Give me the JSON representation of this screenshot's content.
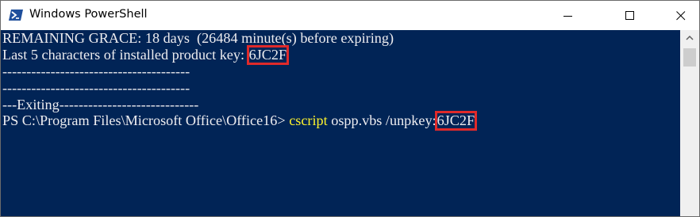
{
  "window": {
    "title": "Windows PowerShell",
    "icon": "powershell-icon",
    "controls": [
      "minimize-icon",
      "maximize-icon",
      "close-icon"
    ]
  },
  "console": {
    "colors": {
      "background": "#012456",
      "text": "#eeedf0",
      "command": "#fdf22d",
      "highlight": "#e02a2a"
    },
    "line1": "REMAINING GRACE: 18 days  (26484 minute(s) before expiring)",
    "line2_prefix": "Last 5 characters of installed product key: ",
    "line2_key": "6JC2F",
    "line3": "---------------------------------------",
    "line4": "---------------------------------------",
    "line5": "---Exiting-----------------------------",
    "prompt": "PS C:\\Program Files\\Microsoft Office\\Office16> ",
    "command": "cscript",
    "command_args": " ospp.vbs /unpkey:",
    "command_key": "6JC2F"
  }
}
